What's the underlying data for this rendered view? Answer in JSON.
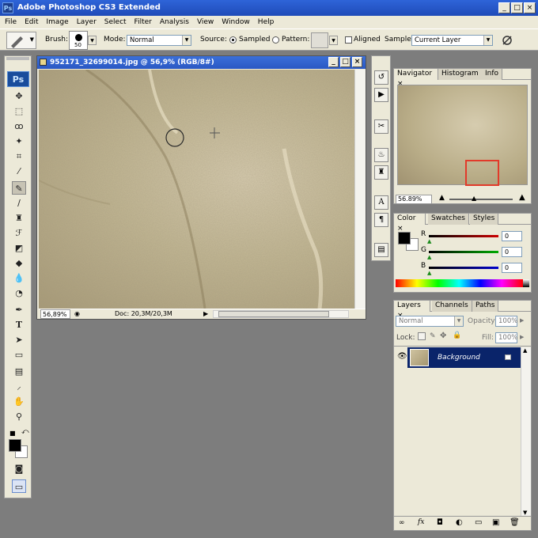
{
  "app": {
    "title": "Adobe Photoshop CS3 Extended",
    "logo": "Ps"
  },
  "window_buttons": [
    "_",
    "□",
    "×"
  ],
  "menu": [
    "File",
    "Edit",
    "Image",
    "Layer",
    "Select",
    "Filter",
    "Analysis",
    "View",
    "Window",
    "Help"
  ],
  "options": {
    "brush_label": "Brush:",
    "brush_size": "50",
    "mode_label": "Mode:",
    "mode_value": "Normal",
    "source_label": "Source:",
    "sampled_label": "Sampled",
    "pattern_label": "Pattern:",
    "aligned_label": "Aligned",
    "sample_label": "Sample:",
    "sample_value": "Current Layer"
  },
  "document": {
    "title": "952171_32699014.jpg @ 56,9% (RGB/8#)",
    "zoom": "56,89%",
    "doc_info": "Doc: 20,3M/20,3M"
  },
  "navigator": {
    "tabs": [
      "Navigator",
      "Histogram",
      "Info"
    ],
    "zoom": "56.89%"
  },
  "color": {
    "tabs": [
      "Color",
      "Swatches",
      "Styles"
    ],
    "r_label": "R",
    "g_label": "G",
    "b_label": "B",
    "r_value": "0",
    "g_value": "0",
    "b_value": "0",
    "r_color": "#cc0000",
    "g_color": "#00aa00",
    "b_color": "#0000cc"
  },
  "layers": {
    "tabs": [
      "Layers",
      "Channels",
      "Paths"
    ],
    "blend_mode": "Normal",
    "opacity_label": "Opacity:",
    "opacity_value": "100%",
    "lock_label": "Lock:",
    "fill_label": "Fill:",
    "fill_value": "100%",
    "layer_name": "Background",
    "selected_color": "#0a246a"
  }
}
